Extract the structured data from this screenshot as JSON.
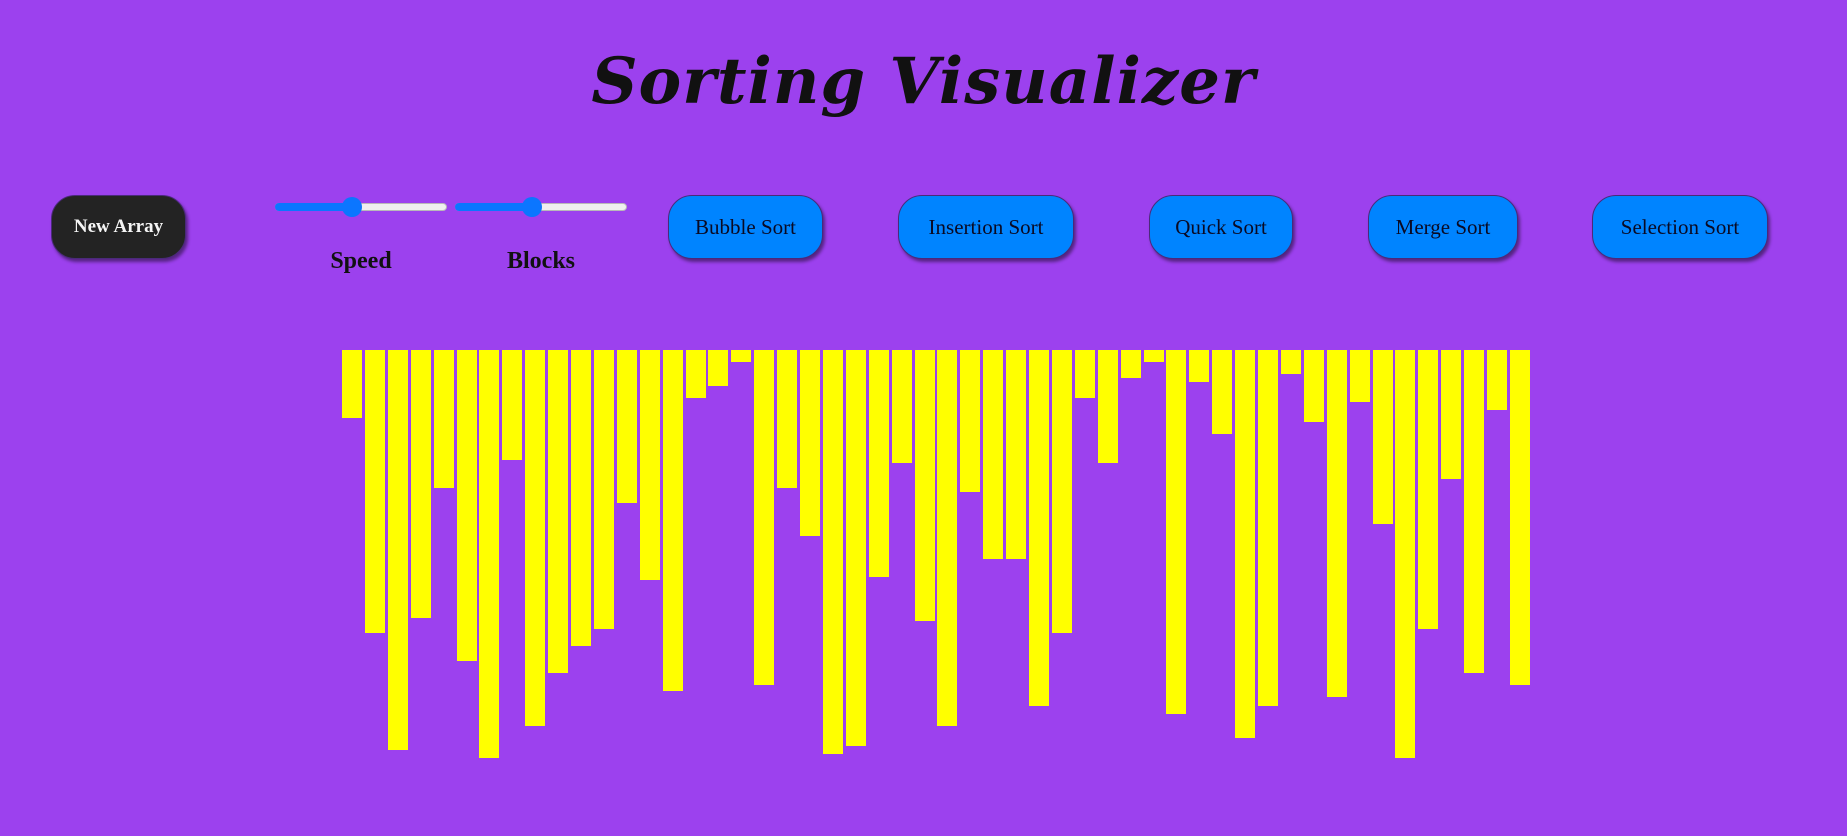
{
  "app": {
    "title": "Sorting Visualizer"
  },
  "controls": {
    "new_array_label": "New Array",
    "speed": {
      "label": "Speed",
      "value": 0.45
    },
    "blocks": {
      "label": "Blocks",
      "value": 0.45
    },
    "sort_buttons": [
      "Bubble Sort",
      "Insertion Sort",
      "Quick Sort",
      "Merge Sort",
      "Selection Sort"
    ]
  },
  "colors": {
    "background": "#9c41ee",
    "bar": "#ffff00",
    "sort_button": "#0084ff",
    "new_array_button": "#232323",
    "slider_accent": "#0b76ff"
  },
  "array": {
    "values": [
      56,
      271,
      388,
      256,
      126,
      299,
      396,
      98,
      364,
      311,
      284,
      267,
      141,
      218,
      329,
      36,
      24,
      0,
      323,
      126,
      174,
      392,
      384,
      215,
      101,
      259,
      364,
      130,
      197,
      197,
      344,
      271,
      36,
      101,
      16,
      0,
      352,
      20,
      72,
      376,
      344,
      12,
      60,
      335,
      40,
      162,
      396,
      267,
      117,
      311,
      48,
      323
    ]
  }
}
